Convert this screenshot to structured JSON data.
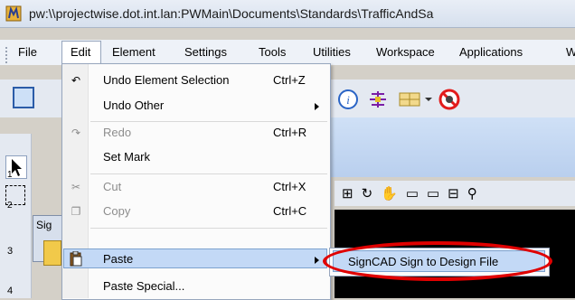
{
  "window": {
    "title": "pw:\\\\projectwise.dot.int.lan:PWMain\\Documents\\Standards\\TrafficAndSa"
  },
  "menubar": {
    "items": [
      {
        "label": "File"
      },
      {
        "label": "Edit"
      },
      {
        "label": "Element"
      },
      {
        "label": "Settings"
      },
      {
        "label": "Tools"
      },
      {
        "label": "Utilities"
      },
      {
        "label": "Workspace"
      },
      {
        "label": "Applications"
      },
      {
        "label": "W"
      }
    ]
  },
  "edit_menu": {
    "items": [
      {
        "label": "Undo Element Selection",
        "shortcut": "Ctrl+Z",
        "enabled": true
      },
      {
        "label": "Undo Other",
        "shortcut": "",
        "enabled": true,
        "submenu": true
      },
      {
        "label": "Redo",
        "shortcut": "Ctrl+R",
        "enabled": false
      },
      {
        "label": "Set Mark",
        "shortcut": "",
        "enabled": true
      },
      {
        "label": "Cut",
        "shortcut": "Ctrl+X",
        "enabled": false
      },
      {
        "label": "Copy",
        "shortcut": "Ctrl+C",
        "enabled": false
      },
      {
        "label": "Paste",
        "shortcut": "",
        "enabled": true,
        "submenu": true,
        "highlighted": true
      },
      {
        "label": "Paste Special...",
        "shortcut": "",
        "enabled": true
      }
    ]
  },
  "paste_submenu": {
    "items": [
      {
        "label": "SignCAD Sign to Design File",
        "highlighted": true
      }
    ]
  },
  "palette": {
    "tools": [
      {
        "label": "1"
      },
      {
        "label": "2"
      },
      {
        "label": "3"
      },
      {
        "label": "4"
      }
    ]
  },
  "dialog_fragment": {
    "title": "Sig"
  },
  "colors": {
    "highlight": "#c3d9f6",
    "annotation_ring": "#e00000"
  }
}
